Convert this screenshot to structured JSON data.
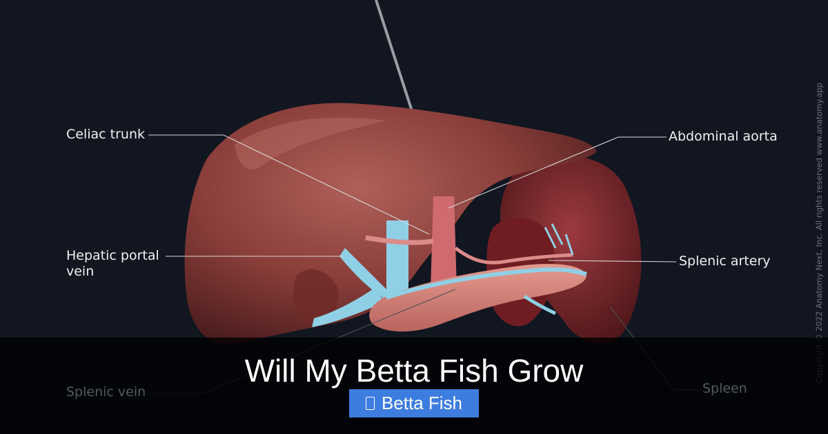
{
  "labels": {
    "celiac_trunk": "Celiac trunk",
    "hepatic_portal_vein": "Hepatic portal vein",
    "splenic_vein": "Splenic vein",
    "abdominal_aorta": "Abdominal aorta",
    "splenic_artery": "Splenic artery",
    "spleen": "Spleen"
  },
  "copyright": "Copyright © 2022 Anatomy Next, Inc. All rights reserved www.anatomy.app",
  "headline": "Will My Betta Fish Grow",
  "tag": {
    "label": "Betta Fish",
    "icon": "tag-icon"
  },
  "colors": {
    "background": "#111620",
    "liver": "#8a3e3a",
    "vein": "#7fc6df",
    "artery": "#c9636a",
    "tag": "#3d7de0"
  }
}
